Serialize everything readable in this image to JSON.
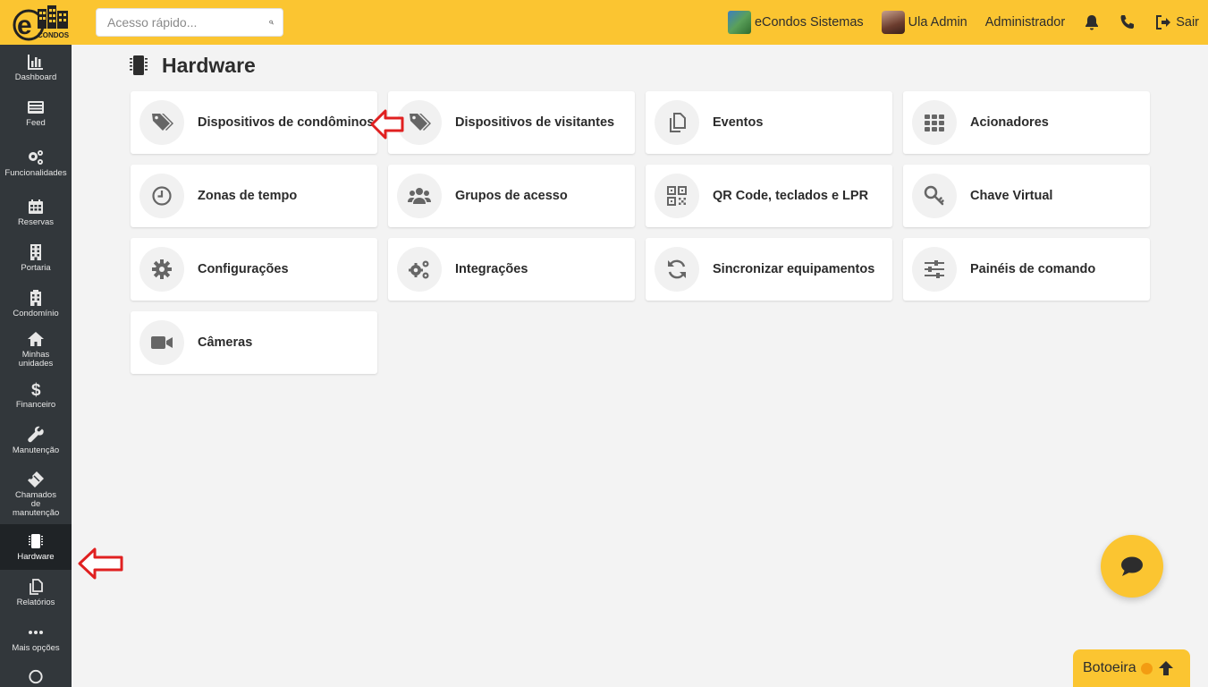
{
  "brand": {
    "logo_text": "CONDOS",
    "logo_letter": "e"
  },
  "search": {
    "placeholder": "Acesso rápido..."
  },
  "topbar": {
    "condo_name": "eCondos Sistemas",
    "user_name": "Ula Admin",
    "role": "Administrador",
    "logout_label": "Sair"
  },
  "sidebar": {
    "items": [
      {
        "label": "Dashboard",
        "icon": "chart-icon"
      },
      {
        "label": "Feed",
        "icon": "feed-icon"
      },
      {
        "label": "Funcionalidades",
        "icon": "gears-icon"
      },
      {
        "label": "Reservas",
        "icon": "calendar-icon"
      },
      {
        "label": "Portaria",
        "icon": "building-icon"
      },
      {
        "label": "Condomínio",
        "icon": "building-icon"
      },
      {
        "label": "Minhas unidades",
        "icon": "home-icon"
      },
      {
        "label": "Financeiro",
        "icon": "dollar-icon"
      },
      {
        "label": "Manutenção",
        "icon": "wrench-icon"
      },
      {
        "label": "Chamados de manutenção",
        "icon": "ticket-icon"
      },
      {
        "label": "Hardware",
        "icon": "chip-icon",
        "active": true
      },
      {
        "label": "Relatórios",
        "icon": "copy-icon"
      },
      {
        "label": "Mais opções",
        "icon": "ellipsis-icon"
      }
    ]
  },
  "page": {
    "title": "Hardware"
  },
  "cards": [
    {
      "label": "Dispositivos de condôminos",
      "icon": "tags-icon"
    },
    {
      "label": "Dispositivos de visitantes",
      "icon": "tags-icon"
    },
    {
      "label": "Eventos",
      "icon": "copy-icon"
    },
    {
      "label": "Acionadores",
      "icon": "grid-icon"
    },
    {
      "label": "Zonas de tempo",
      "icon": "clock-icon"
    },
    {
      "label": "Grupos de acesso",
      "icon": "users-icon"
    },
    {
      "label": "QR Code, teclados e LPR",
      "icon": "qrcode-icon"
    },
    {
      "label": "Chave Virtual",
      "icon": "key-icon"
    },
    {
      "label": "Configurações",
      "icon": "gear-icon"
    },
    {
      "label": "Integrações",
      "icon": "gears-icon"
    },
    {
      "label": "Sincronizar equipamentos",
      "icon": "sync-icon"
    },
    {
      "label": "Painéis de comando",
      "icon": "sliders-icon"
    },
    {
      "label": "Câmeras",
      "icon": "video-icon"
    }
  ],
  "botoeira": {
    "label": "Botoeira"
  },
  "colors": {
    "accent": "#fbc531",
    "sidebar": "#32373b",
    "annotation": "#e02020"
  }
}
